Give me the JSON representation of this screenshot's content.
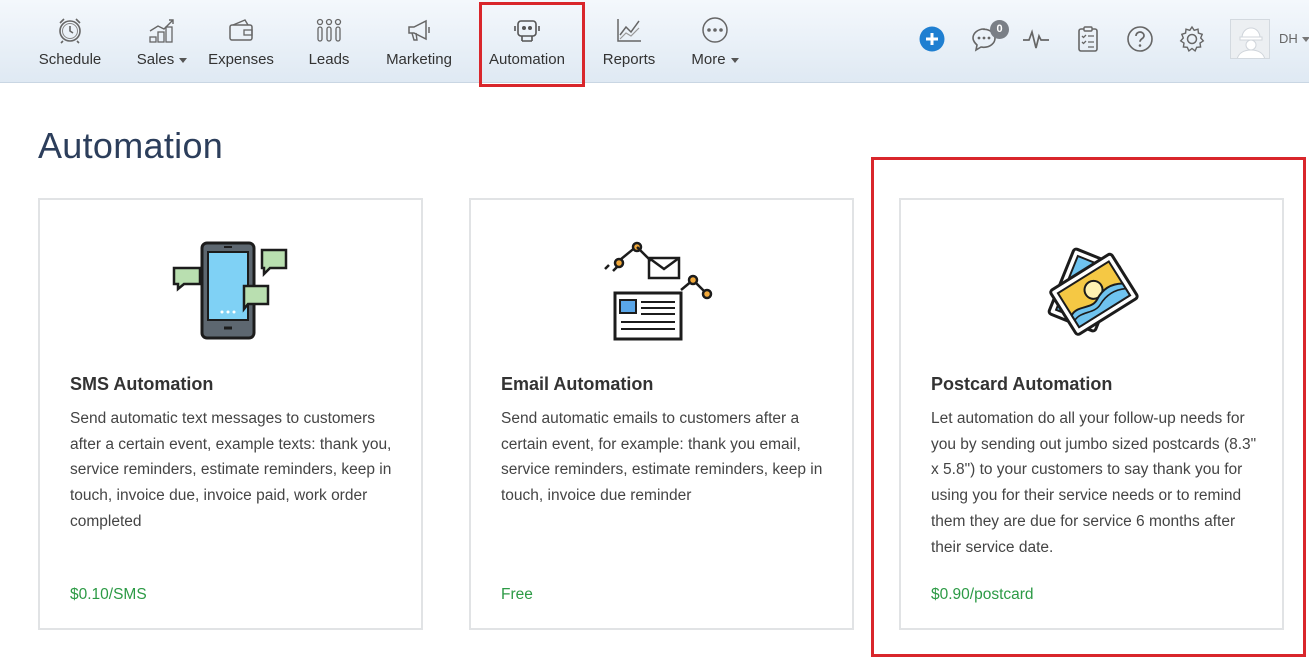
{
  "nav": {
    "items": [
      {
        "label": "Schedule",
        "icon": "alarm-clock-icon",
        "dropdown": false
      },
      {
        "label": "Sales",
        "icon": "coins-chart-icon",
        "dropdown": true
      },
      {
        "label": "Expenses",
        "icon": "wallet-icon",
        "dropdown": false
      },
      {
        "label": "Leads",
        "icon": "people-icon",
        "dropdown": false
      },
      {
        "label": "Marketing",
        "icon": "megaphone-icon",
        "dropdown": false
      },
      {
        "label": "Automation",
        "icon": "robot-icon",
        "dropdown": false
      },
      {
        "label": "Reports",
        "icon": "line-chart-icon",
        "dropdown": false
      },
      {
        "label": "More",
        "icon": "ellipsis-icon",
        "dropdown": true
      }
    ],
    "active": "Automation",
    "notifications_count": "0",
    "user_initials": "DH",
    "highlight_color": "#d9262b",
    "add_button_color": "#1f7fd1"
  },
  "page": {
    "title": "Automation"
  },
  "cards": [
    {
      "title": "SMS Automation",
      "icon": "phone-sms-icon",
      "description": "Send automatic text messages to customers after a certain event, example texts: thank you, service reminders, estimate reminders, keep in touch, invoice due, invoice paid, work order completed",
      "price": "$0.10/SMS"
    },
    {
      "title": "Email Automation",
      "icon": "email-robot-arm-icon",
      "description": "Send automatic emails to customers after a certain event, for example: thank you email, service reminders, estimate reminders, keep in touch, invoice due reminder",
      "price": "Free"
    },
    {
      "title": "Postcard Automation",
      "icon": "postcards-icon",
      "description": "Let automation do all your follow-up needs for you by sending out jumbo sized postcards (8.3\" x 5.8\") to your customers to say thank you for using you for their service needs or to remind them they are due for service 6 months after their service date.",
      "price": "$0.90/postcard"
    }
  ],
  "colors": {
    "price": "#2c9a45",
    "title": "#2c3e5b",
    "highlight": "#d9262b"
  }
}
